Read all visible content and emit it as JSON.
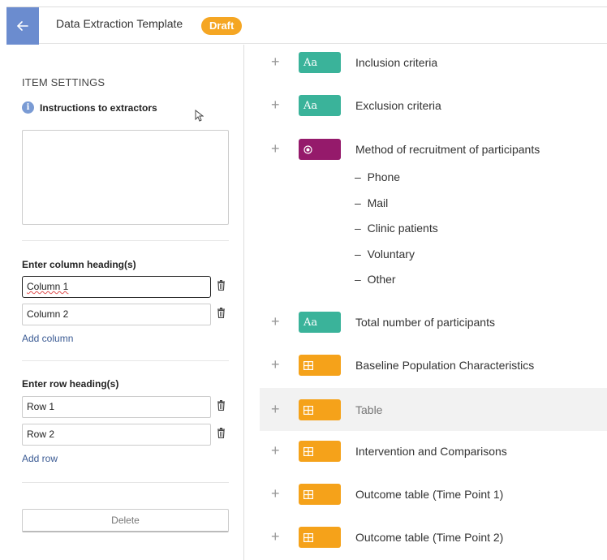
{
  "header": {
    "title": "Data Extraction Template",
    "badge": "Draft"
  },
  "settings": {
    "section_title": "ITEM SETTINGS",
    "instructions_label": "Instructions to extractors",
    "column_heading_label": "Enter column heading(s)",
    "columns": [
      "Column 1",
      "Column 2"
    ],
    "add_column": "Add column",
    "row_heading_label": "Enter row heading(s)",
    "rows": [
      "Row 1",
      "Row 2"
    ],
    "add_row": "Add row",
    "delete_label": "Delete"
  },
  "items": [
    {
      "type": "text",
      "tag": "Aa",
      "label": "Inclusion criteria"
    },
    {
      "type": "text",
      "tag": "Aa",
      "label": "Exclusion criteria"
    },
    {
      "type": "radio",
      "tag": "radio-icon",
      "label": "Method of recruitment of participants",
      "options": [
        "Phone",
        "Mail",
        "Clinic patients",
        "Voluntary",
        "Other"
      ]
    },
    {
      "type": "text",
      "tag": "Aa",
      "label": "Total number of participants"
    },
    {
      "type": "table",
      "tag": "table-icon",
      "label": "Baseline Population Characteristics"
    },
    {
      "type": "table",
      "tag": "table-icon",
      "label": "Table",
      "selected": true
    },
    {
      "type": "table",
      "tag": "table-icon",
      "label": "Intervention and Comparisons"
    },
    {
      "type": "table",
      "tag": "table-icon",
      "label": "Outcome table (Time Point 1)"
    },
    {
      "type": "table",
      "tag": "table-icon",
      "label": "Outcome table (Time Point 2)"
    }
  ],
  "colors": {
    "header_back": "#6b8ccf",
    "badge": "#f5a623",
    "text_tag": "#3ab39a",
    "radio_tag": "#951a6b",
    "table_tag": "#f5a21a",
    "link": "#3a5a93"
  }
}
